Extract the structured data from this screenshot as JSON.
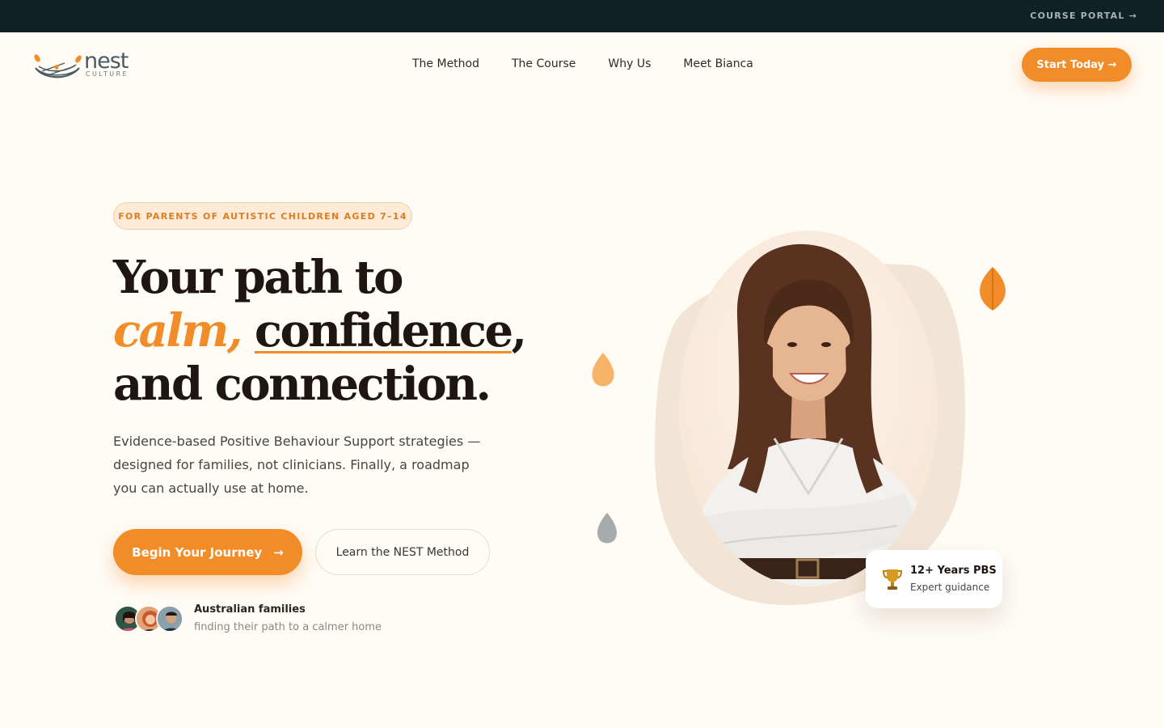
{
  "topbar": {
    "portal_label": "COURSE PORTAL →"
  },
  "brand": {
    "name": "nest",
    "tagline": "CULTURE"
  },
  "nav": {
    "items": [
      {
        "label": "The Method"
      },
      {
        "label": "The Course"
      },
      {
        "label": "Why Us"
      },
      {
        "label": "Meet Bianca"
      }
    ]
  },
  "header": {
    "cta_label": "Start Today →"
  },
  "hero": {
    "eyebrow": "FOR PARENTS OF AUTISTIC CHILDREN AGED 7–14",
    "headline_line1": "Your path to",
    "headline_accent": "calm,",
    "headline_underlined": "confidence",
    "headline_comma": ",",
    "headline_line3": "and connection.",
    "lead": "Evidence-based Positive Behaviour Support strategies — designed for families, not clinicians. Finally, a roadmap you can actually use at home.",
    "primary_cta": "Begin Your Journey",
    "primary_cta_arrow": "→",
    "secondary_cta": "Learn the NEST Method",
    "social_title": "Australian families",
    "social_sub": "finding their path to a calmer home"
  },
  "badge": {
    "title": "12+ Years PBS",
    "subtitle": "Expert guidance",
    "icon": "trophy-icon"
  },
  "colors": {
    "accent": "#f28c28",
    "topbar": "#0f2223",
    "background": "#fffbf5",
    "ink": "#1f1513"
  }
}
